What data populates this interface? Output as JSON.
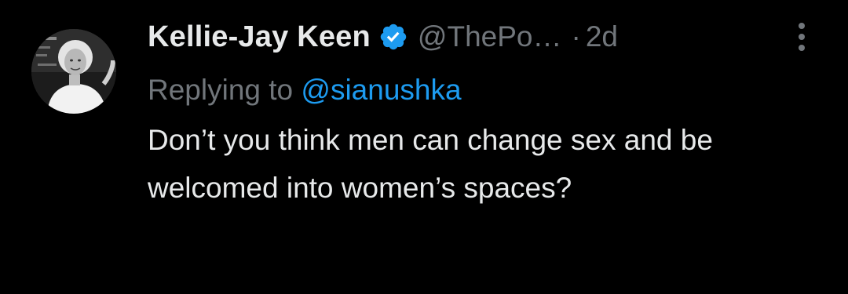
{
  "tweet": {
    "author": {
      "display_name": "Kellie-Jay Keen",
      "handle": "@ThePo…",
      "verified": true,
      "avatar_icon": "avatar-photo"
    },
    "separator": "·",
    "timestamp": "2d",
    "reply_prefix": "Replying to",
    "reply_to": "@sianushka",
    "text": "Don’t you think men can change sex and be welcomed into women’s spaces?",
    "more_icon": "more-vertical-icon"
  },
  "colors": {
    "background": "#000000",
    "primary_text": "#e7e9ea",
    "secondary_text": "#71767b",
    "accent": "#1d9bf0"
  }
}
